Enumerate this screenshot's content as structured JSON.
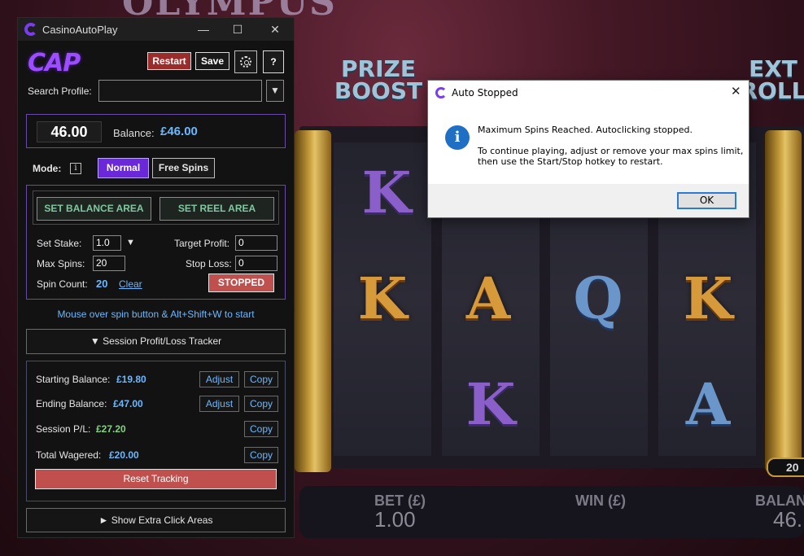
{
  "game": {
    "title_text": "OLYMPUS",
    "badge_left": "PRIZE BOOST",
    "badge_right": "EXT ROLL",
    "reel_symbols": [
      "K",
      "A",
      "K",
      "A",
      "Q",
      "K",
      "K",
      "A"
    ],
    "bottom": {
      "bet_label": "BET (£)",
      "bet_value": "1.00",
      "win_label": "WIN (£)",
      "balance_label": "BALAN",
      "balance_value": "46."
    },
    "counter_badge": "20"
  },
  "cap": {
    "window_title": "CasinoAutoPlay",
    "logo_text": "CAP",
    "toolbar": {
      "restart": "Restart",
      "save": "Save",
      "help": "?"
    },
    "search": {
      "label": "Search Profile:",
      "value": "",
      "dropdown_glyph": "▼"
    },
    "balance": {
      "box_value": "46.00",
      "label": "Balance:",
      "value": "£46.00"
    },
    "mode": {
      "label": "Mode:",
      "info_glyph": "i",
      "normal": "Normal",
      "free_spins": "Free Spins",
      "selected": "Normal"
    },
    "areas": {
      "balance_area": "SET BALANCE AREA",
      "reel_area": "SET REEL AREA"
    },
    "settings": {
      "stake_label": "Set Stake:",
      "stake_value": "1.0",
      "stake_arrow": "▼",
      "target_profit_label": "Target Profit:",
      "target_profit_value": "0",
      "max_spins_label": "Max Spins:",
      "max_spins_value": "20",
      "stop_loss_label": "Stop Loss:",
      "stop_loss_value": "0",
      "spin_count_label": "Spin Count:",
      "spin_count_value": "20",
      "clear_link": "Clear",
      "status_button": "STOPPED"
    },
    "hint": "Mouse over spin button & Alt+Shift+W to start",
    "tracker_toggle": "▼ Session Profit/Loss Tracker",
    "tracker": {
      "starting_label": "Starting Balance:",
      "starting_value": "£19.80",
      "ending_label": "Ending Balance:",
      "ending_value": "£47.00",
      "pl_label": "Session P/L:",
      "pl_value": "£27.20",
      "wagered_label": "Total Wagered:",
      "wagered_value": "£20.00",
      "adjust": "Adjust",
      "copy": "Copy",
      "reset": "Reset Tracking"
    },
    "extra_toggle": "► Show Extra Click Areas",
    "colors": {
      "accent": "#6a28d9",
      "value_blue": "#6ab8ff",
      "profit_green": "#7fd67f",
      "danger": "#c0504d"
    }
  },
  "dialog": {
    "title": "Auto Stopped",
    "close_glyph": "✕",
    "icon_glyph": "i",
    "line1": "Maximum Spins Reached. Autoclicking stopped.",
    "line2": "To continue playing, adjust or remove your max spins limit,",
    "line3": "then use the Start/Stop hotkey to restart.",
    "ok": "OK"
  }
}
